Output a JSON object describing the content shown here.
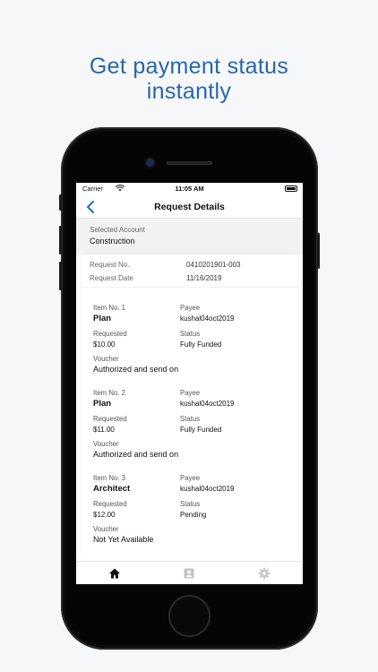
{
  "headline": {
    "line1": "Get payment status",
    "line2": "instantly"
  },
  "status_bar": {
    "carrier": "Carrier",
    "time": "11:05 AM"
  },
  "nav": {
    "title": "Request Details",
    "back_icon": "chevron-left-icon"
  },
  "account": {
    "label": "Selected Account",
    "value": "Construction"
  },
  "request": {
    "no_label": "Request No.",
    "no_value": "0410201901-003",
    "date_label": "Request Date",
    "date_value": "11/16/2019"
  },
  "items": [
    {
      "item_label": "Item No. 1",
      "item_name": "Plan",
      "payee_label": "Payee",
      "payee": "kushal04oct2019",
      "requested_label": "Requested",
      "requested": "$10.00",
      "status_label": "Status",
      "status": "Fully Funded",
      "voucher_label": "Voucher",
      "voucher": "Authorized and send on"
    },
    {
      "item_label": "Item No. 2",
      "item_name": "Plan",
      "payee_label": "Payee",
      "payee": "kushal04oct2019",
      "requested_label": "Requested",
      "requested": "$11.00",
      "status_label": "Status",
      "status": "Fully Funded",
      "voucher_label": "Voucher",
      "voucher": "Authorized and send on"
    },
    {
      "item_label": "Item No. 3",
      "item_name": "Architect",
      "payee_label": "Payee",
      "payee": "kushal04oct2019",
      "requested_label": "Requested",
      "requested": "$12.00",
      "status_label": "Status",
      "status": "Pending",
      "voucher_label": "Voucher",
      "voucher": "Not Yet Available"
    }
  ],
  "tabs": [
    {
      "icon": "home-icon",
      "active": true
    },
    {
      "icon": "contact-card-icon",
      "active": false
    },
    {
      "icon": "gear-icon",
      "active": false
    }
  ],
  "colors": {
    "headline": "#2a66a8",
    "accent": "#1a73c9",
    "active_tab": "#111111",
    "inactive_tab": "#c4c4c4"
  }
}
